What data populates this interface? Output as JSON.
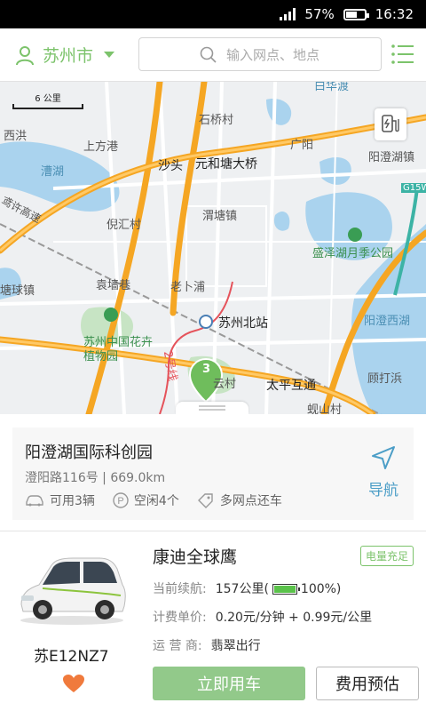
{
  "status_bar": {
    "battery_percent": "57%",
    "time": "16:32"
  },
  "header": {
    "city": "苏州市",
    "search_placeholder": "输入网点、地点"
  },
  "map": {
    "scale_label": "6 公里",
    "labels": {
      "baihuadu": "白华渡",
      "shiqiaocun": "石桥村",
      "xihong": "西洪",
      "shangfangxiang": "上方港",
      "caohu": "漕湖",
      "shatou": "沙头",
      "yuanhetang": "元和塘大桥",
      "yangchenghu_town": "阳澄湖镇",
      "guangyang": "广阳",
      "yuanxu": "鸢许高速",
      "nixucun": "倪汇村",
      "weitang": "渭塘镇",
      "chengzehu_park": "盛泽湖月季公园",
      "qiuzhen": "塘球镇",
      "yuanqiangxiang": "袁墙巷",
      "laobupu": "老卜浦",
      "suzhou_north": "苏州北站",
      "yangcheng_west": "阳澄西湖",
      "botanical": "苏州中国花卉植物园",
      "yuncun": "云村",
      "line2": "2号线",
      "taiping": "太平互通",
      "gudazhen": "顾打浜",
      "xiqiaocun": "蚬山村",
      "highway": "G15W",
      "marker_count": "3"
    }
  },
  "station": {
    "name": "阳澄湖国际科创园",
    "address": "澄阳路116号 | 669.0km",
    "available_cars": "可用3辆",
    "free_parking": "空闲4个",
    "multi_return": "多网点还车",
    "navigate": "导航"
  },
  "car": {
    "model": "康迪全球鹰",
    "badge": "电量充足",
    "plate": "苏E12NZ7",
    "range_label": "当前续航:",
    "range_value": "157公里(",
    "battery_value": "100%)",
    "price_label": "计费单价:",
    "price_value": "0.20元/分钟 + 0.99元/公里",
    "operator_label": "运 营 商:",
    "operator_value": "翡翠出行",
    "rent_button": "立即用车",
    "estimate_button": "费用预估"
  },
  "colors": {
    "accent_green": "#7cc36b",
    "nav_blue": "#4c9ec7",
    "heart": "#f07a3c"
  }
}
